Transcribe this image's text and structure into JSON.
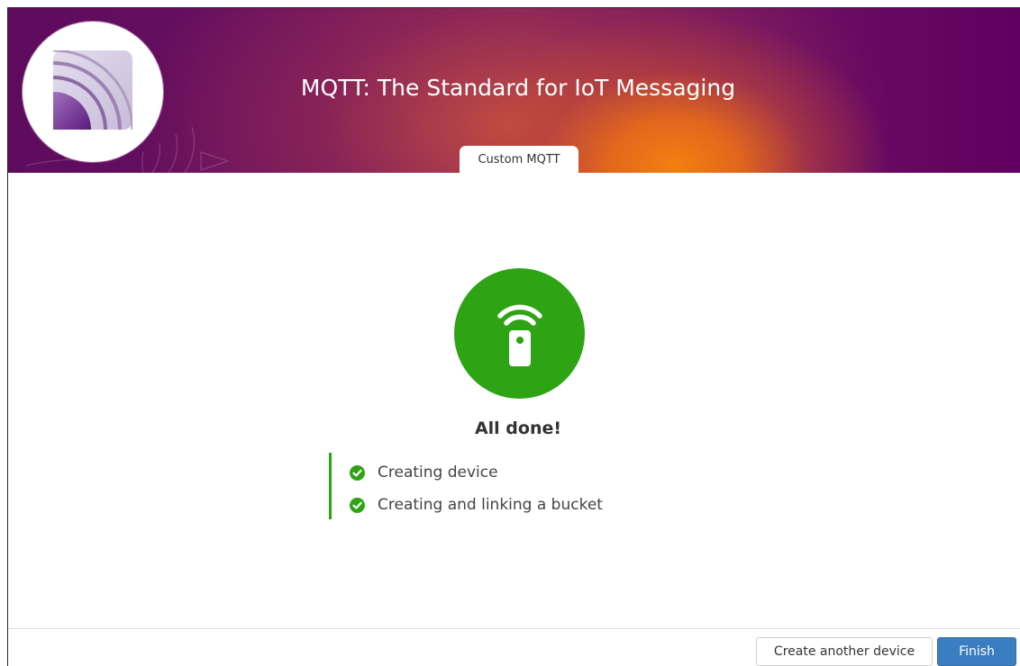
{
  "header": {
    "title": "MQTT: The Standard for IoT Messaging",
    "logo_icon": "mqtt-signal-logo-icon",
    "active_tab": "Custom MQTT"
  },
  "status": {
    "icon": "wireless-device-icon",
    "title": "All done!",
    "color": "#2ea414",
    "steps": [
      {
        "label": "Creating device",
        "icon": "check-circle-icon",
        "state": "complete"
      },
      {
        "label": "Creating and linking a bucket",
        "icon": "check-circle-icon",
        "state": "complete"
      }
    ]
  },
  "footer": {
    "create_another_label": "Create another device",
    "finish_label": "Finish",
    "primary_color": "#3b7dc1"
  }
}
